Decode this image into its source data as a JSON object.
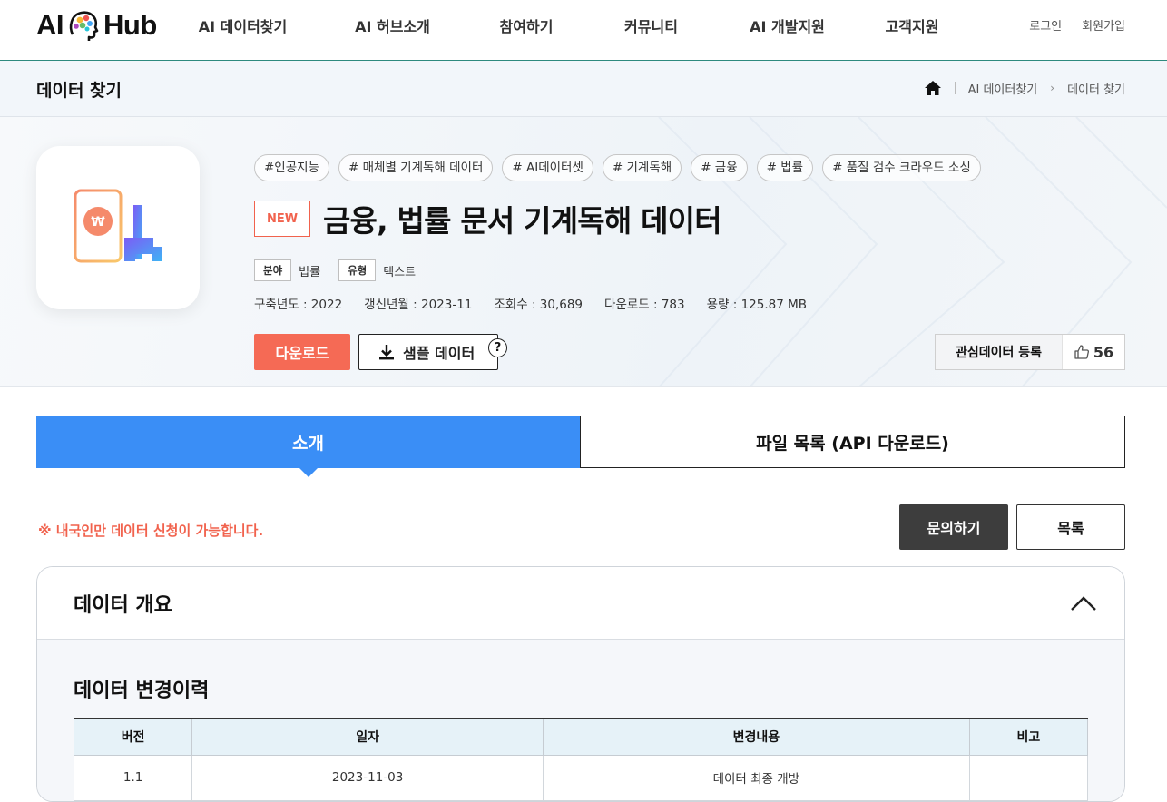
{
  "logo": {
    "left": "AI",
    "right": "Hub"
  },
  "nav": [
    "AI 데이터찾기",
    "AI 허브소개",
    "참여하기",
    "커뮤니티",
    "AI 개발지원",
    "고객지원"
  ],
  "util": {
    "login": "로그인",
    "signup": "회원가입"
  },
  "subheader": {
    "title": "데이터 찾기",
    "breadcrumb": [
      "AI 데이터찾기",
      "데이터 찾기"
    ]
  },
  "dataset": {
    "tags": [
      "#인공지능",
      "# 매체별 기계독해 데이터",
      "# AI데이터셋",
      "# 기계독해",
      "# 금융",
      "# 법률",
      "# 품질 검수 크라우드 소싱"
    ],
    "badge": "NEW",
    "title": "금융, 법률 문서 기계독해 데이터",
    "field_label": "분야",
    "field_value": "법률",
    "type_label": "유형",
    "type_value": "텍스트",
    "stats": {
      "year": "구축년도 : 2022",
      "updated": "갱신년월 : 2023-11",
      "views": "조회수 : 30,689",
      "downloads": "다운로드 : 783",
      "size": "용량 : 125.87 MB"
    },
    "download_label": "다운로드",
    "sample_label": "샘플 데이터",
    "help": "?",
    "fav_label": "관심데이터 등록",
    "likes": "56"
  },
  "tabs": [
    "소개",
    "파일 목록 (API 다운로드)"
  ],
  "notice": "※ 내국인만 데이터 신청이 가능합니다.",
  "buttons": {
    "inquiry": "문의하기",
    "list": "목록"
  },
  "overview": {
    "title": "데이터 개요",
    "history_title": "데이터 변경이력",
    "columns": [
      "버전",
      "일자",
      "변경내용",
      "비고"
    ],
    "rows": [
      [
        "1.1",
        "2023-11-03",
        "데이터 최종 개방",
        ""
      ]
    ]
  },
  "colors": {
    "accent": "#3a8ef6",
    "download": "#f56a55",
    "notice": "#f1624d"
  },
  "icons": [
    "home-icon",
    "download-icon",
    "thumbs-up-icon",
    "chevron-up-icon",
    "help-icon"
  ]
}
